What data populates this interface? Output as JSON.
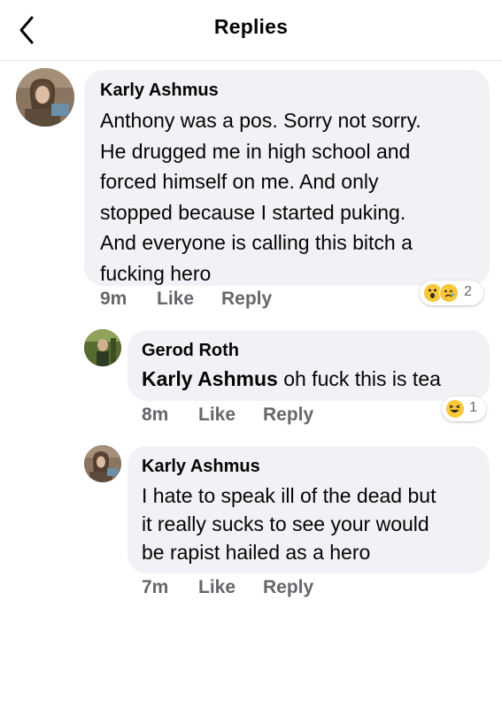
{
  "header": {
    "title": "Replies",
    "back_icon": "chevron-left-icon"
  },
  "comments": [
    {
      "author": "Karly Ashmus",
      "lines": [
        "Anthony was a pos. Sorry not sorry.",
        "He drugged me in high school and",
        "forced himself on me. And only",
        "stopped because I started puking.",
        "And everyone is calling this bitch a",
        "fucking hero"
      ],
      "time": "9m",
      "like_label": "Like",
      "reply_label": "Reply",
      "reactions": {
        "icons": [
          "wow-emoji-icon",
          "sad-emoji-icon"
        ],
        "count": "2"
      }
    },
    {
      "author": "Gerod Roth",
      "mention": "Karly Ashmus",
      "text": " oh fuck this is tea",
      "time": "8m",
      "like_label": "Like",
      "reply_label": "Reply",
      "reactions": {
        "icons": [
          "haha-emoji-icon"
        ],
        "count": "1"
      }
    },
    {
      "author": "Karly Ashmus",
      "lines": [
        "I hate to speak ill of the dead but",
        "it really sucks to see your would",
        "be rapist hailed as a hero"
      ],
      "time": "7m",
      "like_label": "Like",
      "reply_label": "Reply"
    }
  ],
  "colors": {
    "bubble": "#f0f2f5",
    "secondary_text": "#65676b",
    "reaction_yellow": "#f7c93a"
  }
}
